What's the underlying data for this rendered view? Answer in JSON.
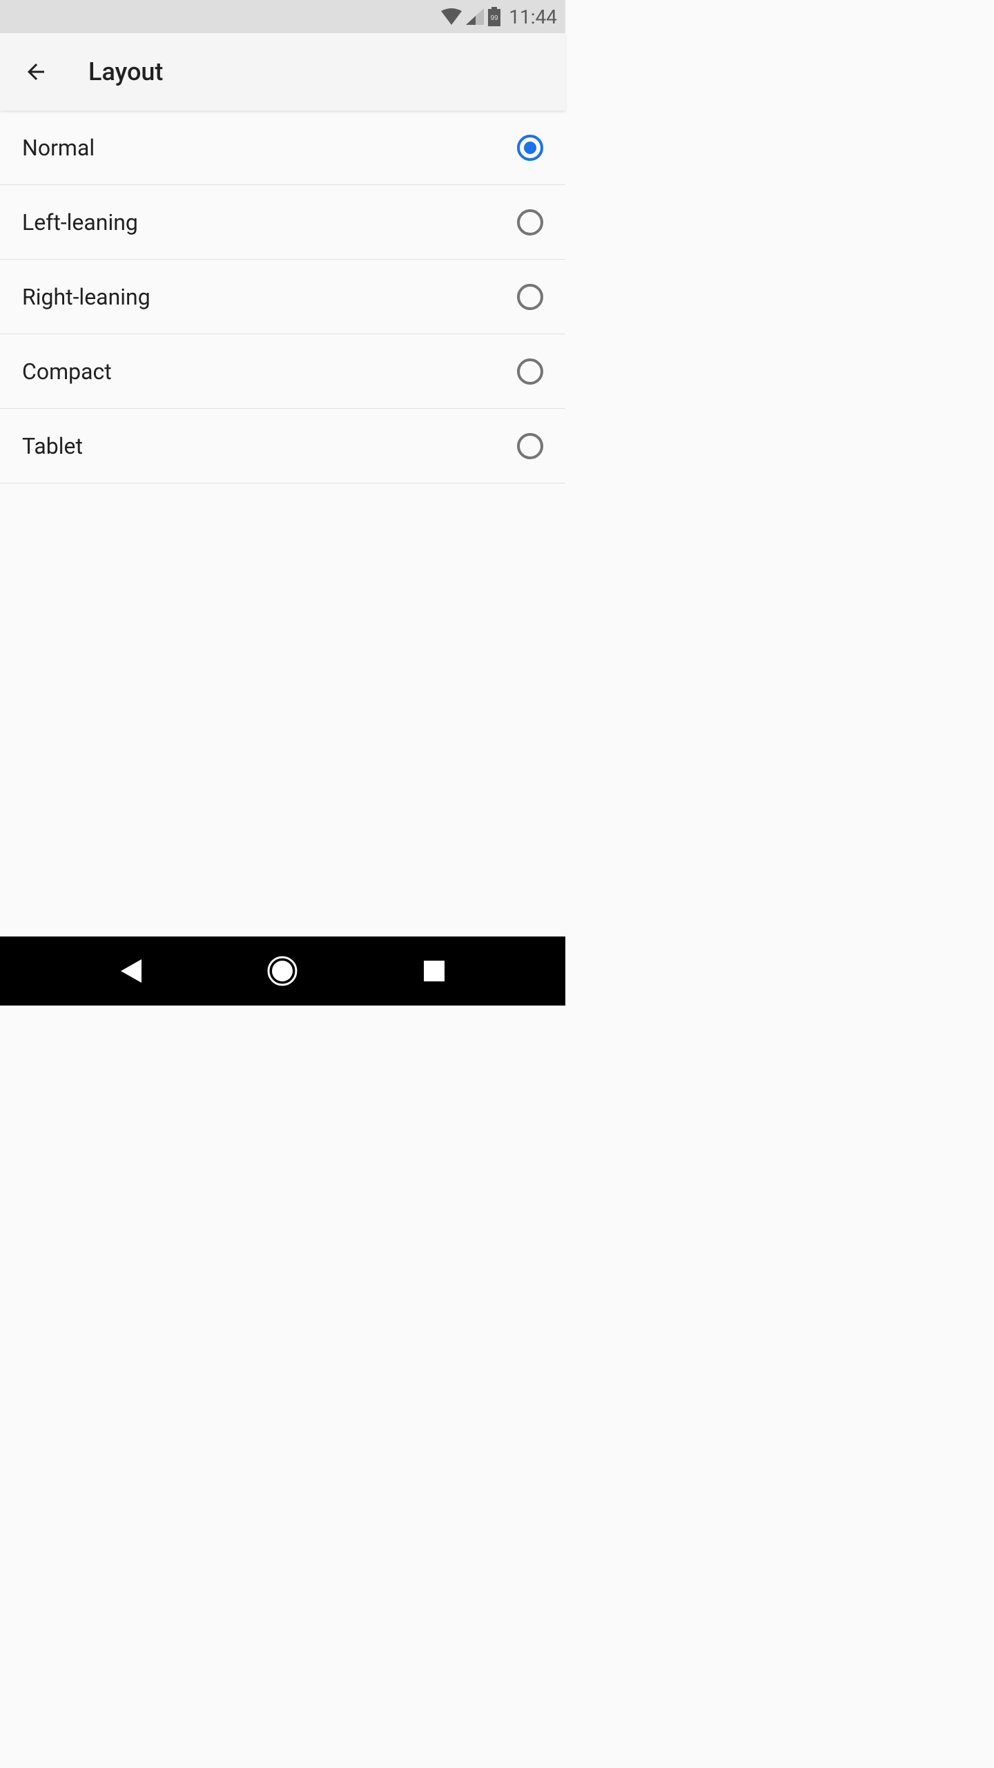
{
  "status": {
    "time": "11:44",
    "battery_level": "99"
  },
  "header": {
    "title": "Layout"
  },
  "options": [
    {
      "label": "Normal",
      "selected": true
    },
    {
      "label": "Left-leaning",
      "selected": false
    },
    {
      "label": "Right-leaning",
      "selected": false
    },
    {
      "label": "Compact",
      "selected": false
    },
    {
      "label": "Tablet",
      "selected": false
    }
  ]
}
